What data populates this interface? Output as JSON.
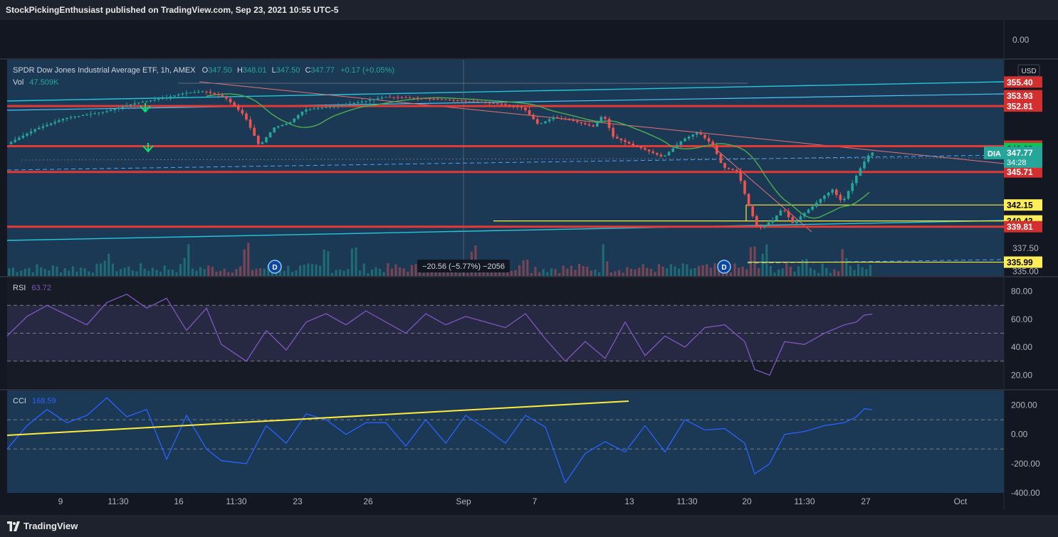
{
  "header": {
    "publisher": "StockPickingEnthusiast published on TradingView.com, Sep 23, 2021 10:55 UTC-5"
  },
  "legend": {
    "title": "SPDR Dow Jones Industrial Average ETF, 1h, AMEX",
    "o_label": "O",
    "o": "347.50",
    "h_label": "H",
    "h": "348.01",
    "l_label": "L",
    "l": "347.50",
    "c_label": "C",
    "c": "347.77",
    "chg": "+0.17 (+0.05%)",
    "vol_label": "Vol",
    "vol": "47.509K",
    "currency": "USD"
  },
  "measure_label": "−20.56 (−5.77%) −2056",
  "dividend_marker": "D",
  "top_pane_label": "0.00",
  "rsi": {
    "label": "RSI",
    "value": "63.72"
  },
  "cci": {
    "label": "CCI",
    "value": "168.59"
  },
  "footer": {
    "brand": "TradingView"
  },
  "colors": {
    "bg": "#131722",
    "price_pane": "#1b3954",
    "rsi_band": "#2a2a46",
    "up": "#26a69a",
    "down": "#ef5350",
    "level_red": "#e53935",
    "yellow": "#ffeb3b",
    "cyan": "#26c6da",
    "ma_green": "#4caf50",
    "rsi_line": "#7e57c2",
    "cci_line": "#2962ff"
  },
  "chart_data": {
    "type": "candlestick",
    "symbol": "DIA",
    "timeframe": "1h",
    "x_ticks": [
      "9",
      "11:30",
      "16",
      "11:30",
      "23",
      "26",
      "Sep",
      "7",
      "13",
      "11:30",
      "20",
      "11:30",
      "27",
      "Oct"
    ],
    "price_axis": {
      "range": [
        334.5,
        357.8
      ],
      "ticks": [
        "335.00",
        "337.50"
      ],
      "level_labels": [
        {
          "value": 355.4,
          "label": "355.40",
          "kind": "red"
        },
        {
          "value": 353.93,
          "label": "353.93",
          "kind": "red"
        },
        {
          "value": 352.81,
          "label": "352.81",
          "kind": "red"
        },
        {
          "value": 348.49,
          "label": "348.49",
          "kind": "red"
        },
        {
          "value": 348.23,
          "label": "348.23",
          "kind": "green"
        },
        {
          "value": 345.71,
          "label": "345.71",
          "kind": "red"
        },
        {
          "value": 342.15,
          "label": "342.15",
          "kind": "yellow"
        },
        {
          "value": 340.43,
          "label": "340.43",
          "kind": "yellow"
        },
        {
          "value": 339.81,
          "label": "339.81",
          "kind": "red"
        },
        {
          "value": 335.99,
          "label": "335.99",
          "kind": "yellow"
        }
      ],
      "last_price": {
        "symbol": "DIA",
        "value": 347.77,
        "label": "347.77",
        "countdown": "34:28"
      }
    },
    "horizontal_levels": [
      352.81,
      348.49,
      345.71,
      339.81
    ],
    "yellow_levels": [
      342.15,
      340.43,
      335.99
    ],
    "price_path": [
      [
        0,
        348.6
      ],
      [
        0.03,
        350.3
      ],
      [
        0.06,
        351.5
      ],
      [
        0.1,
        352.2
      ],
      [
        0.13,
        353.1
      ],
      [
        0.16,
        353.7
      ],
      [
        0.18,
        354.2
      ],
      [
        0.2,
        354.4
      ],
      [
        0.22,
        353.8
      ],
      [
        0.24,
        351.8
      ],
      [
        0.255,
        348.5
      ],
      [
        0.27,
        350.5
      ],
      [
        0.285,
        351.0
      ],
      [
        0.3,
        352.4
      ],
      [
        0.33,
        352.8
      ],
      [
        0.36,
        353.3
      ],
      [
        0.38,
        353.8
      ],
      [
        0.41,
        353.7
      ],
      [
        0.44,
        353.5
      ],
      [
        0.47,
        353.3
      ],
      [
        0.5,
        353.0
      ],
      [
        0.52,
        352.6
      ],
      [
        0.535,
        350.8
      ],
      [
        0.55,
        351.6
      ],
      [
        0.57,
        351.2
      ],
      [
        0.59,
        350.6
      ],
      [
        0.6,
        351.9
      ],
      [
        0.61,
        349.5
      ],
      [
        0.625,
        348.8
      ],
      [
        0.64,
        348.2
      ],
      [
        0.66,
        347.3
      ],
      [
        0.68,
        349.2
      ],
      [
        0.695,
        350.0
      ],
      [
        0.71,
        348.6
      ],
      [
        0.72,
        346.2
      ],
      [
        0.735,
        345.8
      ],
      [
        0.745,
        342.3
      ],
      [
        0.755,
        339.6
      ],
      [
        0.77,
        340.5
      ],
      [
        0.78,
        341.8
      ],
      [
        0.79,
        340.2
      ],
      [
        0.81,
        342.0
      ],
      [
        0.82,
        343.0
      ],
      [
        0.83,
        343.8
      ],
      [
        0.84,
        342.4
      ],
      [
        0.85,
        344.5
      ],
      [
        0.86,
        346.5
      ],
      [
        0.868,
        347.8
      ]
    ],
    "volume_spikes": [
      0.1,
      0.18,
      0.24,
      0.32,
      0.35,
      0.47,
      0.52,
      0.6,
      0.75,
      0.76,
      0.8,
      0.84
    ],
    "rsi": {
      "range": [
        10,
        90
      ],
      "ticks": [
        "80.00",
        "60.00",
        "40.00",
        "20.00"
      ],
      "levels": [
        70,
        50,
        30
      ],
      "path": [
        [
          0,
          48
        ],
        [
          0.02,
          62
        ],
        [
          0.04,
          70
        ],
        [
          0.06,
          63
        ],
        [
          0.08,
          56
        ],
        [
          0.1,
          72
        ],
        [
          0.12,
          78
        ],
        [
          0.14,
          68
        ],
        [
          0.16,
          75
        ],
        [
          0.18,
          52
        ],
        [
          0.2,
          68
        ],
        [
          0.215,
          42
        ],
        [
          0.24,
          30
        ],
        [
          0.26,
          52
        ],
        [
          0.28,
          38
        ],
        [
          0.3,
          58
        ],
        [
          0.32,
          64
        ],
        [
          0.34,
          56
        ],
        [
          0.36,
          66
        ],
        [
          0.38,
          58
        ],
        [
          0.4,
          50
        ],
        [
          0.42,
          64
        ],
        [
          0.44,
          56
        ],
        [
          0.46,
          62
        ],
        [
          0.48,
          58
        ],
        [
          0.5,
          54
        ],
        [
          0.52,
          64
        ],
        [
          0.54,
          46
        ],
        [
          0.56,
          30
        ],
        [
          0.58,
          44
        ],
        [
          0.6,
          32
        ],
        [
          0.62,
          58
        ],
        [
          0.64,
          34
        ],
        [
          0.66,
          48
        ],
        [
          0.68,
          40
        ],
        [
          0.7,
          54
        ],
        [
          0.72,
          56
        ],
        [
          0.74,
          44
        ],
        [
          0.75,
          24
        ],
        [
          0.765,
          20
        ],
        [
          0.78,
          44
        ],
        [
          0.8,
          42
        ],
        [
          0.82,
          50
        ],
        [
          0.84,
          56
        ],
        [
          0.852,
          58
        ],
        [
          0.86,
          63
        ],
        [
          0.868,
          63.72
        ]
      ]
    },
    "cci": {
      "range": [
        -400,
        300
      ],
      "ticks": [
        "200.00",
        "0.00",
        "-200.00",
        "-400.00"
      ],
      "levels": [
        100,
        -100
      ],
      "path": [
        [
          0,
          -100
        ],
        [
          0.02,
          60
        ],
        [
          0.04,
          170
        ],
        [
          0.06,
          80
        ],
        [
          0.08,
          130
        ],
        [
          0.1,
          250
        ],
        [
          0.12,
          120
        ],
        [
          0.14,
          170
        ],
        [
          0.16,
          -170
        ],
        [
          0.18,
          130
        ],
        [
          0.2,
          -100
        ],
        [
          0.215,
          -180
        ],
        [
          0.24,
          -200
        ],
        [
          0.26,
          60
        ],
        [
          0.28,
          -60
        ],
        [
          0.3,
          140
        ],
        [
          0.32,
          100
        ],
        [
          0.34,
          0
        ],
        [
          0.36,
          80
        ],
        [
          0.38,
          80
        ],
        [
          0.4,
          -80
        ],
        [
          0.42,
          100
        ],
        [
          0.44,
          -60
        ],
        [
          0.46,
          130
        ],
        [
          0.48,
          40
        ],
        [
          0.5,
          -60
        ],
        [
          0.52,
          130
        ],
        [
          0.54,
          50
        ],
        [
          0.56,
          -330
        ],
        [
          0.58,
          -130
        ],
        [
          0.6,
          -50
        ],
        [
          0.62,
          -120
        ],
        [
          0.64,
          60
        ],
        [
          0.66,
          -120
        ],
        [
          0.68,
          100
        ],
        [
          0.7,
          30
        ],
        [
          0.72,
          40
        ],
        [
          0.74,
          -60
        ],
        [
          0.75,
          -270
        ],
        [
          0.765,
          -200
        ],
        [
          0.78,
          0
        ],
        [
          0.8,
          20
        ],
        [
          0.82,
          60
        ],
        [
          0.84,
          80
        ],
        [
          0.852,
          120
        ],
        [
          0.86,
          175
        ],
        [
          0.868,
          168.59
        ]
      ]
    }
  }
}
